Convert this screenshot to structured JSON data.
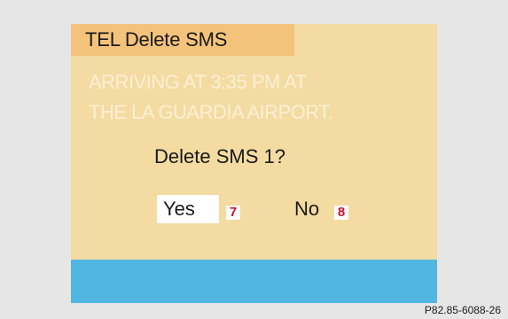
{
  "screen": {
    "title": "TEL Delete SMS",
    "message_lines": [
      "ARRIVING AT 3:35 PM AT",
      "THE LA GUARDIA AIRPORT."
    ],
    "prompt": "Delete SMS 1?",
    "options": {
      "yes": "Yes",
      "no": "No"
    },
    "selected_option": "Yes"
  },
  "callouts": {
    "yes": "7",
    "no": "8",
    "color": "#c8102e"
  },
  "colors": {
    "screen_background": "#f3dba2",
    "title_bar": "#f4c37b",
    "bottom_band": "#52b6e2",
    "page_background": "#e6e6e6"
  },
  "figure_reference": "P82.85-6088-26"
}
